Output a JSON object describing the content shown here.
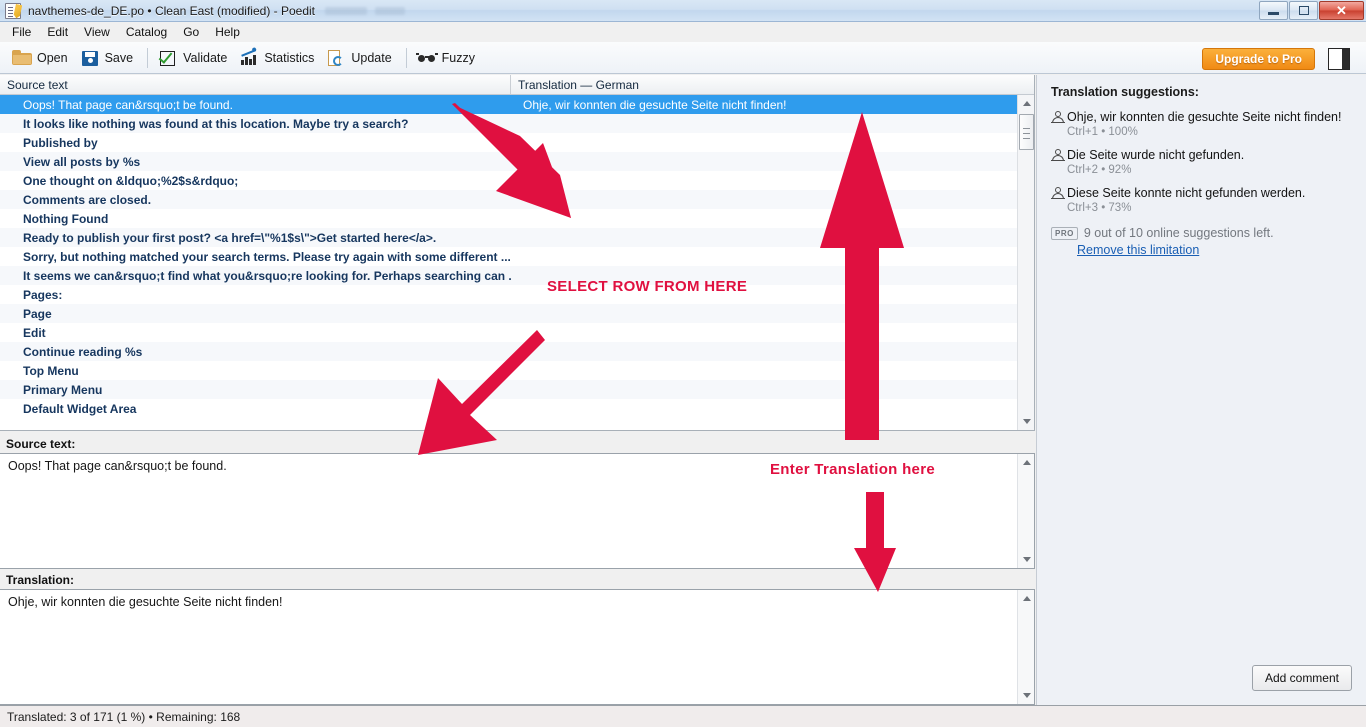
{
  "window": {
    "title": "navthemes-de_DE.po • Clean East (modified) - Poedit",
    "icon": "poedit-document-icon",
    "buttons": {
      "minimize": "minimize-icon",
      "maximize": "maximize-icon",
      "close": "✕"
    }
  },
  "menu": [
    {
      "label": "File"
    },
    {
      "label": "Edit"
    },
    {
      "label": "View"
    },
    {
      "label": "Catalog"
    },
    {
      "label": "Go"
    },
    {
      "label": "Help"
    }
  ],
  "toolbar": {
    "buttons": [
      {
        "label": "Open",
        "icon": "folder-open-icon"
      },
      {
        "label": "Save",
        "icon": "floppy-disk-icon"
      },
      {
        "label": "Validate",
        "icon": "checkbox-check-icon"
      },
      {
        "label": "Statistics",
        "icon": "bar-chart-icon"
      },
      {
        "label": "Update",
        "icon": "page-refresh-icon"
      },
      {
        "label": "Fuzzy",
        "icon": "glasses-icon"
      }
    ],
    "upgrade_label": "Upgrade to Pro",
    "sidebar_toggle": "sidebar-panel-icon"
  },
  "list": {
    "columns": {
      "source": "Source text",
      "translation": "Translation — German"
    },
    "rows": [
      {
        "source": "Oops! That page can&rsquo;t be found.",
        "translation": "Ohje, wir konnten die gesuchte Seite nicht finden!",
        "selected": true
      },
      {
        "source": "It looks like nothing was found at this location. Maybe try a search?",
        "translation": ""
      },
      {
        "source": "Published by",
        "translation": ""
      },
      {
        "source": "View all posts by %s",
        "translation": ""
      },
      {
        "source": "One thought on &ldquo;%2$s&rdquo;",
        "translation": ""
      },
      {
        "source": "Comments are closed.",
        "translation": ""
      },
      {
        "source": "Nothing Found",
        "translation": ""
      },
      {
        "source": "Ready to publish your first post? <a href=\\\"%1$s\\\">Get started here</a>.",
        "translation": ""
      },
      {
        "source": "Sorry, but nothing matched your search terms. Please try again with some different ...",
        "translation": ""
      },
      {
        "source": "It seems we can&rsquo;t find what you&rsquo;re looking for. Perhaps searching can ...",
        "translation": ""
      },
      {
        "source": "Pages:",
        "translation": ""
      },
      {
        "source": "Page",
        "translation": ""
      },
      {
        "source": "Edit",
        "translation": ""
      },
      {
        "source": "Continue reading %s",
        "translation": ""
      },
      {
        "source": "Top Menu",
        "translation": ""
      },
      {
        "source": "Primary Menu",
        "translation": ""
      },
      {
        "source": "Default Widget Area",
        "translation": ""
      }
    ]
  },
  "source_panel": {
    "label": "Source text:",
    "value": "Oops! That page can&rsquo;t be found."
  },
  "translation_panel": {
    "label": "Translation:",
    "value": "Ohje, wir konnten die gesuchte Seite nicht finden!"
  },
  "sidebar": {
    "title": "Translation suggestions:",
    "suggestions": [
      {
        "text": "Ohje, wir konnten die gesuchte Seite nicht finden!",
        "meta": "Ctrl+1 • 100%",
        "icon": "person-icon"
      },
      {
        "text": "Die Seite wurde nicht gefunden.",
        "meta": "Ctrl+2 • 92%",
        "icon": "person-icon"
      },
      {
        "text": "Diese Seite konnte nicht gefunden werden.",
        "meta": "Ctrl+3 • 73%",
        "icon": "person-icon"
      }
    ],
    "pro_badge": "PRO",
    "pro_text": "9 out of 10 online suggestions left.",
    "pro_link": "Remove this limitation",
    "add_comment": "Add comment"
  },
  "statusbar": {
    "text": "Translated: 3 of 171 (1 %)  •  Remaining: 168"
  },
  "annotations": {
    "select_row": "SELECT  ROW FROM HERE",
    "enter_translation": "Enter Translation here",
    "color": "#e01040"
  },
  "colors": {
    "selection_blue": "#2f9ced",
    "row_text": "#16365e",
    "accent_orange": "#f08a14",
    "link_blue": "#1a5fb4",
    "annotation_red": "#e01040"
  }
}
